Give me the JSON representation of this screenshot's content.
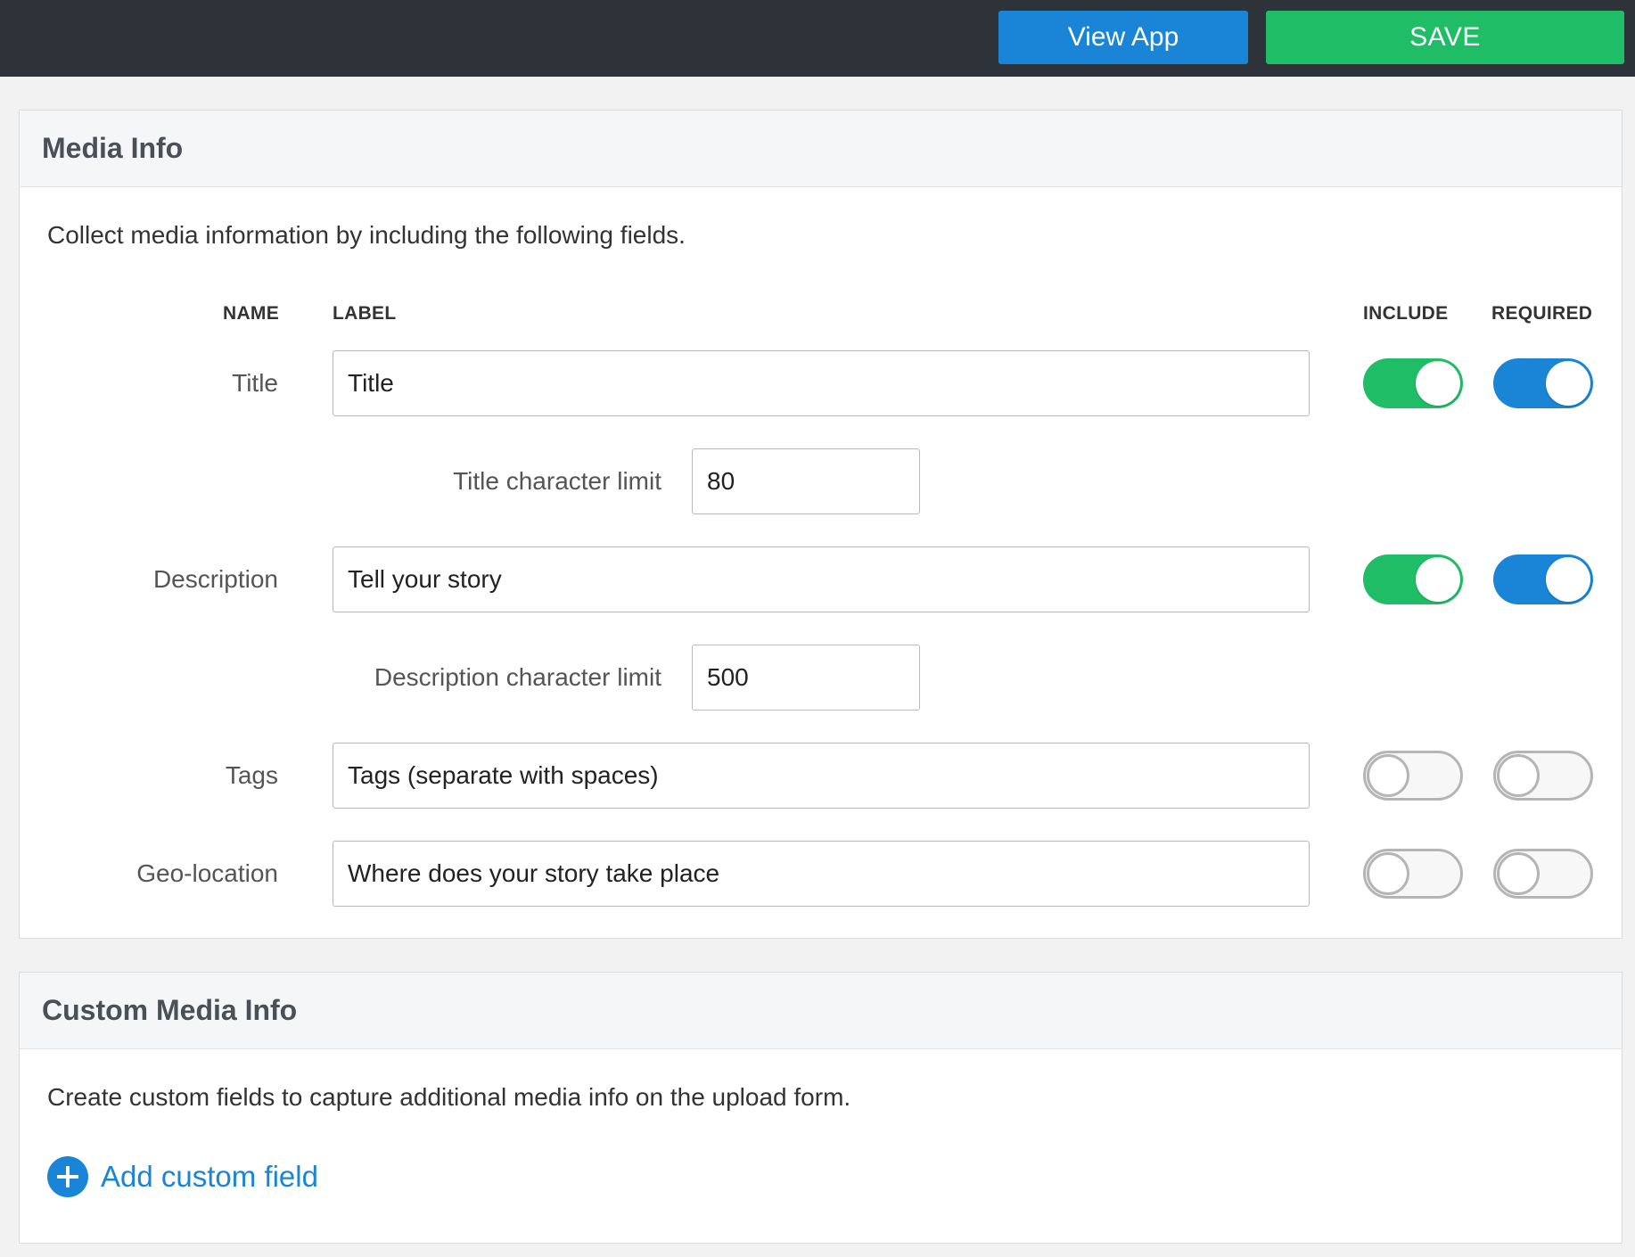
{
  "topbar": {
    "view_app_label": "View App",
    "save_label": "SAVE"
  },
  "media_info": {
    "title": "Media Info",
    "description": "Collect media information by including the following fields.",
    "columns": {
      "name": "NAME",
      "label": "LABEL",
      "include": "INCLUDE",
      "required": "REQUIRED"
    },
    "fields": [
      {
        "name": "Title",
        "label_value": "Title",
        "include": true,
        "required": true
      },
      {
        "name": "Description",
        "label_value": "Tell your story",
        "include": true,
        "required": true
      },
      {
        "name": "Tags",
        "label_value": "Tags (separate with spaces)",
        "include": false,
        "required": false
      },
      {
        "name": "Geo-location",
        "label_value": "Where does your story take place",
        "include": false,
        "required": false
      }
    ],
    "title_limit": {
      "label": "Title character limit",
      "value": "80"
    },
    "description_limit": {
      "label": "Description character limit",
      "value": "500"
    }
  },
  "custom_media_info": {
    "title": "Custom Media Info",
    "description": "Create custom fields to capture additional media info on the upload form.",
    "add_label": "Add custom field"
  },
  "colors": {
    "topbar": "#2e333a",
    "view_app": "#1a85d6",
    "save": "#1fbe66",
    "include_on": "#1fbe66",
    "required_on": "#1a85d6"
  },
  "icons": {
    "add": "plus-circle-icon"
  }
}
